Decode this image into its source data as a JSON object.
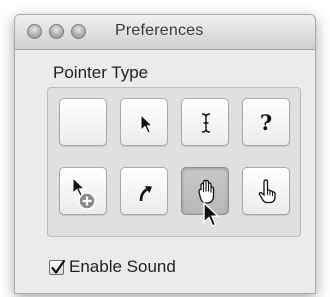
{
  "window": {
    "title": "Preferences",
    "buttons": [
      "close",
      "minimize",
      "zoom"
    ]
  },
  "pointer_type": {
    "label": "Pointer Type",
    "options": [
      {
        "icon": "blank",
        "selected": false
      },
      {
        "icon": "arrow-pointer-icon",
        "selected": false
      },
      {
        "icon": "i-beam-icon",
        "selected": false
      },
      {
        "icon": "help-icon",
        "text": "?",
        "selected": false
      },
      {
        "icon": "copy-pointer-icon",
        "selected": false
      },
      {
        "icon": "alias-pointer-icon",
        "selected": false
      },
      {
        "icon": "open-hand-icon",
        "selected": true
      },
      {
        "icon": "pointing-hand-icon",
        "selected": false
      }
    ]
  },
  "sound": {
    "label": "Enable Sound",
    "checked": true
  }
}
